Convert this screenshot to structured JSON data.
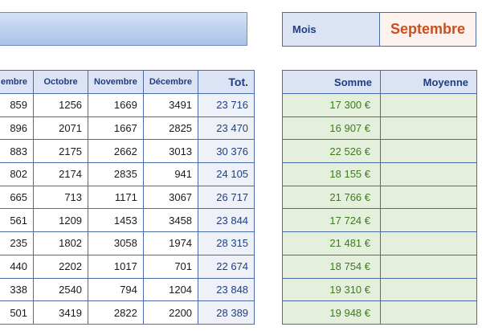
{
  "mois": {
    "label": "Mois",
    "value": "Septembre"
  },
  "main_table": {
    "headers": [
      "embre",
      "Octobre",
      "Novembre",
      "Décembre",
      "Tot."
    ],
    "rows": [
      [
        "859",
        "1256",
        "1669",
        "3491",
        "23 716"
      ],
      [
        "896",
        "2071",
        "1667",
        "2825",
        "23 470"
      ],
      [
        "883",
        "2175",
        "2662",
        "3013",
        "30 376"
      ],
      [
        "802",
        "2174",
        "2835",
        "941",
        "24 105"
      ],
      [
        "665",
        "713",
        "1171",
        "3067",
        "26 717"
      ],
      [
        "561",
        "1209",
        "1453",
        "3458",
        "23 844"
      ],
      [
        "235",
        "1802",
        "3058",
        "1974",
        "28 315"
      ],
      [
        "440",
        "2202",
        "1017",
        "701",
        "22 674"
      ],
      [
        "338",
        "2540",
        "794",
        "1204",
        "23 848"
      ],
      [
        "501",
        "3419",
        "2822",
        "2200",
        "28 389"
      ]
    ]
  },
  "summary_table": {
    "headers": [
      "Somme",
      "Moyenne"
    ],
    "rows": [
      [
        "17 300 €",
        ""
      ],
      [
        "16 907 €",
        ""
      ],
      [
        "22 526 €",
        ""
      ],
      [
        "18 155 €",
        ""
      ],
      [
        "21 766 €",
        ""
      ],
      [
        "17 724 €",
        ""
      ],
      [
        "21 481 €",
        ""
      ],
      [
        "18 754 €",
        ""
      ],
      [
        "19 310 €",
        ""
      ],
      [
        "19 948 €",
        ""
      ]
    ]
  }
}
